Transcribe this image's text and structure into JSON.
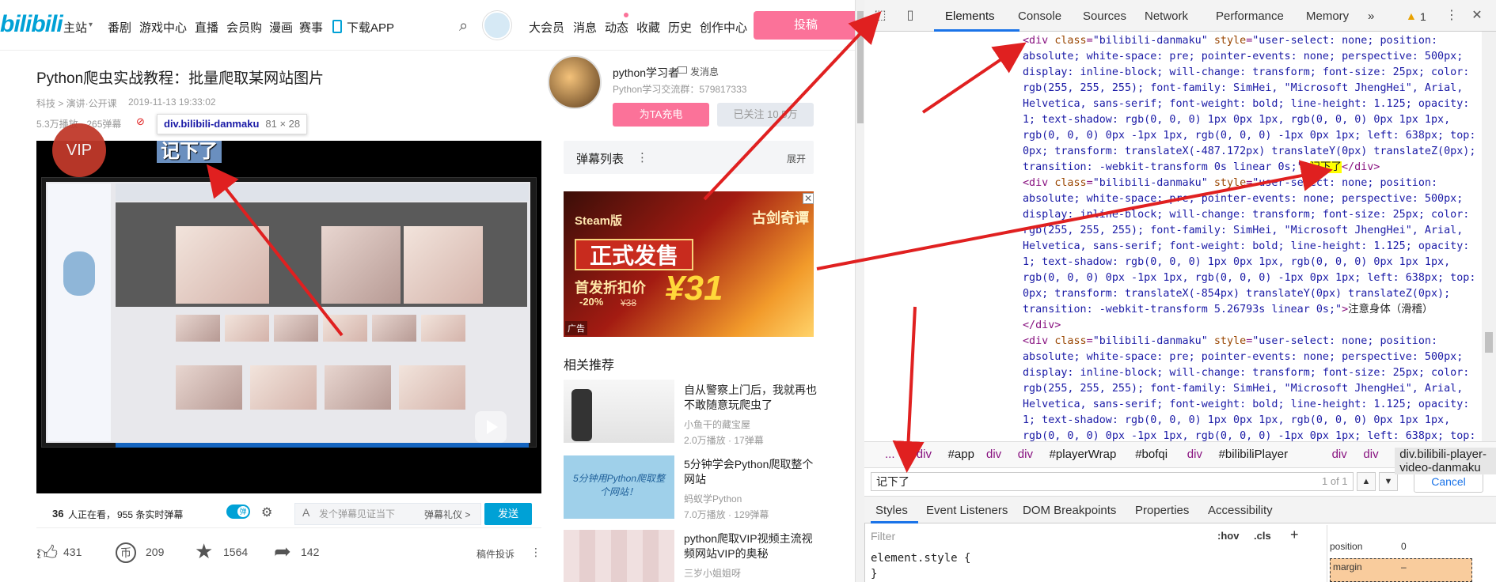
{
  "site": {
    "logo": "bilibili",
    "nav": [
      "主站",
      "番剧",
      "游戏中心",
      "直播",
      "会员购",
      "漫画",
      "赛事",
      "下载APP"
    ],
    "right_nav": [
      "大会员",
      "消息",
      "动态",
      "收藏",
      "历史",
      "创作中心"
    ],
    "upload": "投稿"
  },
  "video": {
    "title": "Python爬虫实战教程：批量爬取某网站图片",
    "category": "科技 > 演讲·公开课",
    "date": "2019-11-13 19:33:02",
    "plays": "5.3万播放 · 265弹幕",
    "vip_badge": "VIP",
    "danmaku_text": "记下了",
    "watching_count": "36",
    "watching_label": "人正在看，",
    "danmaku_count": "955 条实时弹幕",
    "danmaku_toggle": "弹",
    "danmaku_placeholder": "发个弹幕见证当下",
    "danmaku_etiquette": "弹幕礼仪 >",
    "send": "发送",
    "likes": "431",
    "coins": "209",
    "favorites": "1564",
    "shares": "142",
    "report": "稿件投诉"
  },
  "tooltip": {
    "selector": "div.bilibili-danmaku",
    "size": "81 × 28"
  },
  "uploader": {
    "name": "python学习者",
    "message": "发消息",
    "desc": "Python学习交流群：579817333",
    "charge": "为TA充电",
    "follow": "已关注 10.5万"
  },
  "danmaku_list": {
    "title": "弹幕列表",
    "menu": "⋮",
    "expand": "展开"
  },
  "ad": {
    "steam": "Steam版",
    "title": "正式发售",
    "sub": "首发折扣价",
    "discount": "-20%",
    "original": "¥38",
    "price": "¥31",
    "brand": "古剑奇谭",
    "label": "广告",
    "close": "✕"
  },
  "related": {
    "heading": "相关推荐",
    "items": [
      {
        "title": "自从警察上门后，我就再也不敢随意玩爬虫了",
        "up": "小鱼干的藏宝屋",
        "stats": "2.0万播放 · 17弹幕"
      },
      {
        "title": "5分钟学会Python爬取整个网站",
        "up": "蚂蚁学Python",
        "stats": "7.0万播放 · 129弹幕",
        "thumb_text": "5分钟用Python爬取整个网站！"
      },
      {
        "title": "python爬取VIP视频主流视频网站VIP的奥秘",
        "up": "三岁小姐姐呀",
        "stats": ""
      }
    ]
  },
  "devtools": {
    "tabs": [
      "Elements",
      "Console",
      "Sources",
      "Network",
      "Performance",
      "Memory"
    ],
    "more": "»",
    "warn_count": "1",
    "code_lines": [
      {
        "segments": [
          [
            "tag",
            "<div "
          ],
          [
            "an",
            "class"
          ],
          [
            "tag",
            "="
          ],
          [
            "av",
            "\"bilibili-danmaku\""
          ],
          [
            "tag",
            " "
          ],
          [
            "an",
            "style"
          ],
          [
            "tag",
            "="
          ],
          [
            "av",
            "\"user-select: none; position:"
          ]
        ]
      },
      {
        "segments": [
          [
            "av",
            "absolute; white-space: pre; pointer-events: none; perspective: 500px;"
          ]
        ]
      },
      {
        "segments": [
          [
            "av",
            "display: inline-block; will-change: transform; font-size: 25px; color:"
          ]
        ]
      },
      {
        "segments": [
          [
            "av",
            "rgb(255, 255, 255); font-family: SimHei, \"Microsoft JhengHei\", Arial,"
          ]
        ]
      },
      {
        "segments": [
          [
            "av",
            "Helvetica, sans-serif; font-weight: bold; line-height: 1.125; opacity:"
          ]
        ]
      },
      {
        "segments": [
          [
            "av",
            "1; text-shadow: rgb(0, 0, 0) 1px 0px 1px, rgb(0, 0, 0) 0px 1px 1px,"
          ]
        ]
      },
      {
        "segments": [
          [
            "av",
            "rgb(0, 0, 0) 0px -1px 1px, rgb(0, 0, 0) -1px 0px 1px; left: 638px; top:"
          ]
        ]
      },
      {
        "segments": [
          [
            "av",
            "0px; transform: translateX(-487.172px) translateY(0px) translateZ(0px);"
          ]
        ]
      },
      {
        "segments": [
          [
            "av",
            "transition: -webkit-transform 0s linear 0s;\""
          ],
          [
            "tag",
            ">"
          ],
          [
            "hl",
            "记下了"
          ],
          [
            "tag",
            "</div>"
          ]
        ]
      },
      {
        "segments": [
          [
            "tag",
            "<div "
          ],
          [
            "an",
            "class"
          ],
          [
            "tag",
            "="
          ],
          [
            "av",
            "\"bilibili-danmaku\""
          ],
          [
            "tag",
            " "
          ],
          [
            "an",
            "style"
          ],
          [
            "tag",
            "="
          ],
          [
            "av",
            "\"user-select: none; position:"
          ]
        ]
      },
      {
        "segments": [
          [
            "av",
            "absolute; white-space: pre; pointer-events: none; perspective: 500px;"
          ]
        ]
      },
      {
        "segments": [
          [
            "av",
            "display: inline-block; will-change: transform; font-size: 25px; color:"
          ]
        ]
      },
      {
        "segments": [
          [
            "av",
            "rgb(255, 255, 255); font-family: SimHei, \"Microsoft JhengHei\", Arial,"
          ]
        ]
      },
      {
        "segments": [
          [
            "av",
            "Helvetica, sans-serif; font-weight: bold; line-height: 1.125; opacity:"
          ]
        ]
      },
      {
        "segments": [
          [
            "av",
            "1; text-shadow: rgb(0, 0, 0) 1px 0px 1px, rgb(0, 0, 0) 0px 1px 1px,"
          ]
        ]
      },
      {
        "segments": [
          [
            "av",
            "rgb(0, 0, 0) 0px -1px 1px, rgb(0, 0, 0) -1px 0px 1px; left: 638px; top:"
          ]
        ]
      },
      {
        "segments": [
          [
            "av",
            "0px; transform: translateX(-854px) translateY(0px) translateZ(0px);"
          ]
        ]
      },
      {
        "segments": [
          [
            "av",
            "transition: -webkit-transform 5.26793s linear 0s;\""
          ],
          [
            "tag",
            ">"
          ],
          [
            "txt",
            "注意身体（滑稽）"
          ]
        ]
      },
      {
        "segments": [
          [
            "tag",
            "</div>"
          ]
        ]
      },
      {
        "segments": [
          [
            "tag",
            "<div "
          ],
          [
            "an",
            "class"
          ],
          [
            "tag",
            "="
          ],
          [
            "av",
            "\"bilibili-danmaku\""
          ],
          [
            "tag",
            " "
          ],
          [
            "an",
            "style"
          ],
          [
            "tag",
            "="
          ],
          [
            "av",
            "\"user-select: none; position:"
          ]
        ]
      },
      {
        "segments": [
          [
            "av",
            "absolute; white-space: pre; pointer-events: none; perspective: 500px;"
          ]
        ]
      },
      {
        "segments": [
          [
            "av",
            "display: inline-block; will-change: transform; font-size: 25px; color:"
          ]
        ]
      },
      {
        "segments": [
          [
            "av",
            "rgb(255, 255, 255); font-family: SimHei, \"Microsoft JhengHei\", Arial,"
          ]
        ]
      },
      {
        "segments": [
          [
            "av",
            "Helvetica, sans-serif; font-weight: bold; line-height: 1.125; opacity:"
          ]
        ]
      },
      {
        "segments": [
          [
            "av",
            "1; text-shadow: rgb(0, 0, 0) 1px 0px 1px, rgb(0, 0, 0) 0px 1px 1px,"
          ]
        ]
      },
      {
        "segments": [
          [
            "av",
            "rgb(0, 0, 0) 0px -1px 1px, rgb(0, 0, 0) -1px 0px 1px; left: 638px; top:"
          ]
        ]
      }
    ],
    "breadcrumbs": [
      "...",
      "div",
      "#app",
      "div",
      "div",
      "#playerWrap",
      "#bofqi",
      "div",
      "#bilibiliPlayer",
      "div",
      "div",
      "div.bilibili-player-video-danmaku"
    ],
    "search_value": "记下了",
    "search_count": "1 of 1",
    "cancel": "Cancel",
    "subtabs": [
      "Styles",
      "Event Listeners",
      "DOM Breakpoints",
      "Properties",
      "Accessibility"
    ],
    "filter_placeholder": "Filter",
    "hov": ":hov",
    ".cls": ".cls",
    "plus": "+",
    "element_style": "element.style {",
    "close_brace": "}",
    "box_position": "position",
    "box_position_value": "0",
    "box_margin": "margin",
    "box_margin_value": "–"
  },
  "colors": {
    "bili_blue": "#00a1d6",
    "bili_pink": "#fb7299",
    "annotation_red": "#e02020",
    "devtools_accent": "#1a73e8"
  }
}
